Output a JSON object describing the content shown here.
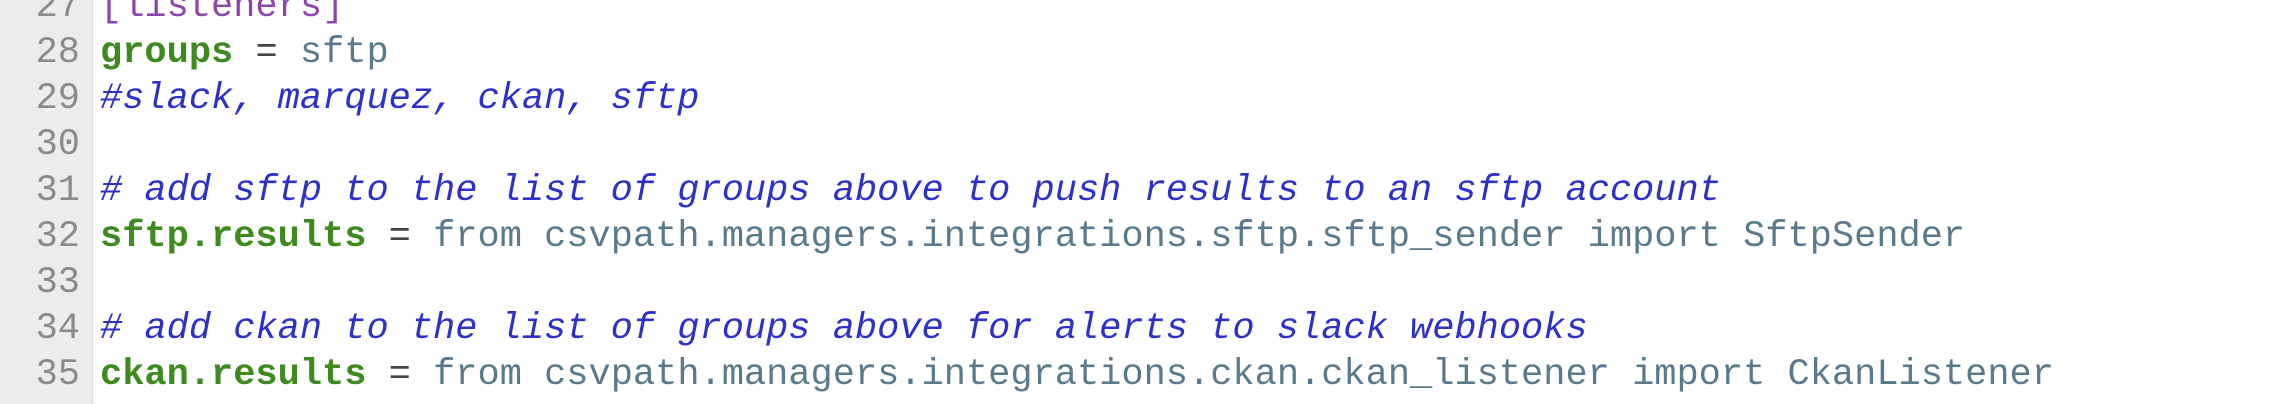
{
  "editor": {
    "lines": [
      {
        "number": "27",
        "section": "[listeners]"
      },
      {
        "number": "28",
        "key": "groups",
        "op": " = ",
        "value": "sftp"
      },
      {
        "number": "29",
        "comment": "#slack, marquez, ckan, sftp"
      },
      {
        "number": "30"
      },
      {
        "number": "31",
        "comment": "# add sftp to the list of groups above to push results to an sftp account"
      },
      {
        "number": "32",
        "key": "sftp.results",
        "op": " = ",
        "value": "from csvpath.managers.integrations.sftp.sftp_sender import SftpSender"
      },
      {
        "number": "33"
      },
      {
        "number": "34",
        "comment": "# add ckan to the list of groups above for alerts to slack webhooks"
      },
      {
        "number": "35",
        "key": "ckan.results",
        "op": " = ",
        "value": "from csvpath.managers.integrations.ckan.ckan_listener import CkanListener"
      }
    ]
  }
}
